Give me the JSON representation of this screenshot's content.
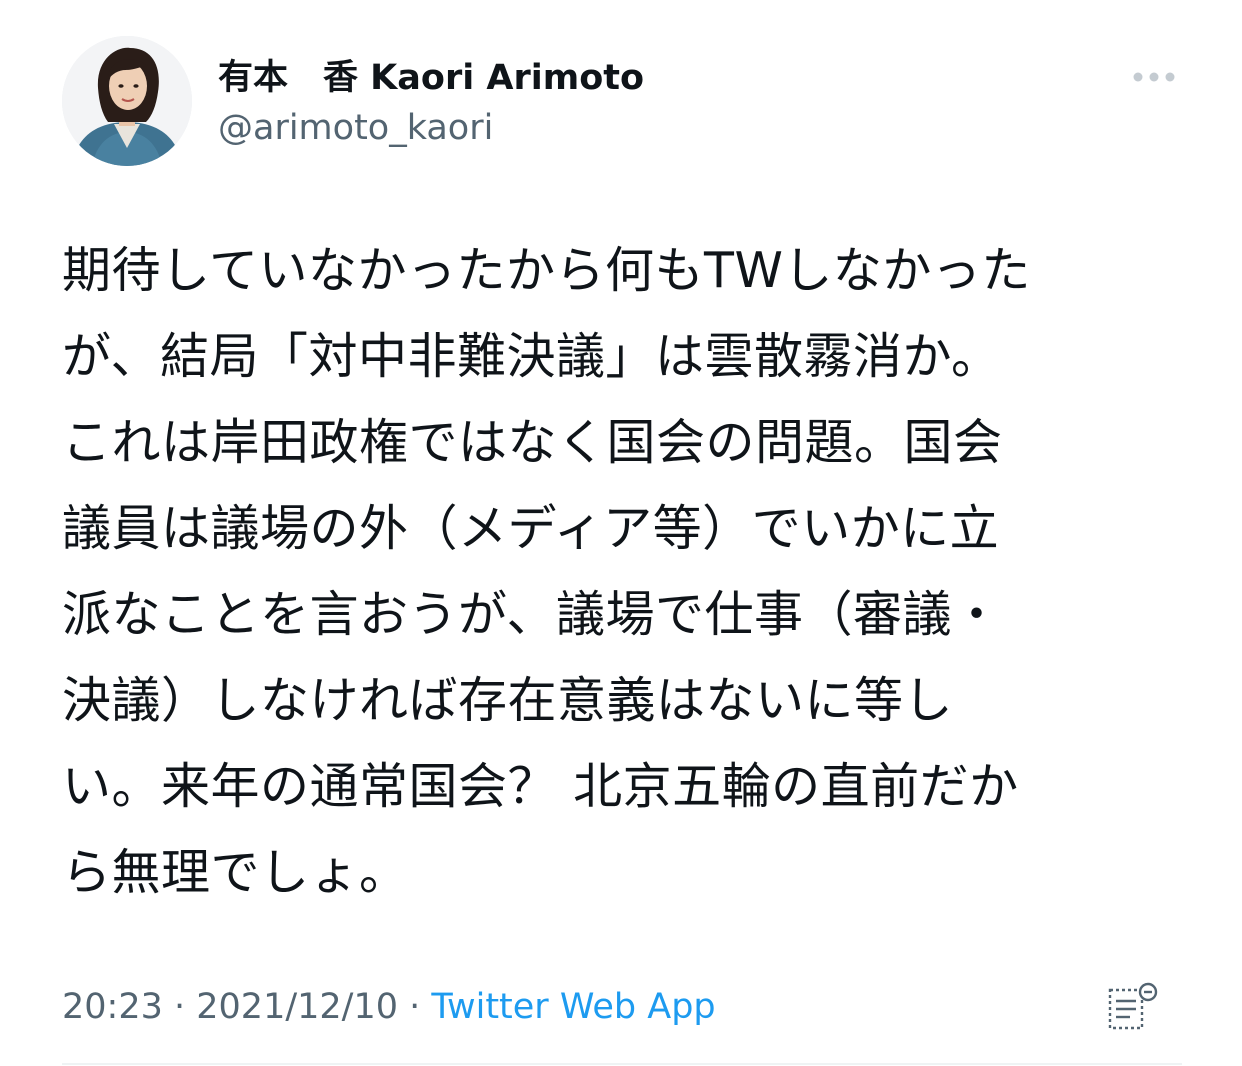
{
  "tweet": {
    "author": {
      "display_name": "有本　香  Kaori Arimoto",
      "handle": "@arimoto_kaori"
    },
    "text_lines": [
      "期待していなかったから何もTWしなかった",
      "が、結局「対中非難決議」は雲散霧消か。",
      "これは岸田政権ではなく国会の問題。国会",
      "議員は議場の外（メディア等）でいかに立",
      "派なことを言おうが、議場で仕事（審議・",
      "決議）しなければ存在意義はないに等し",
      "い。来年の通常国会？ 北京五輪の直前だか",
      "ら無理でしょ。"
    ],
    "time": "20:23",
    "date": "2021/12/10",
    "separator": " · ",
    "source": "Twitter Web App"
  },
  "icons": {
    "more": "more-horizontal-icon",
    "analytics": "view-analytics-icon"
  },
  "colors": {
    "text": "#0f1419",
    "secondary": "#536471",
    "link": "#1d9bf0",
    "divider": "#eff3f4"
  }
}
